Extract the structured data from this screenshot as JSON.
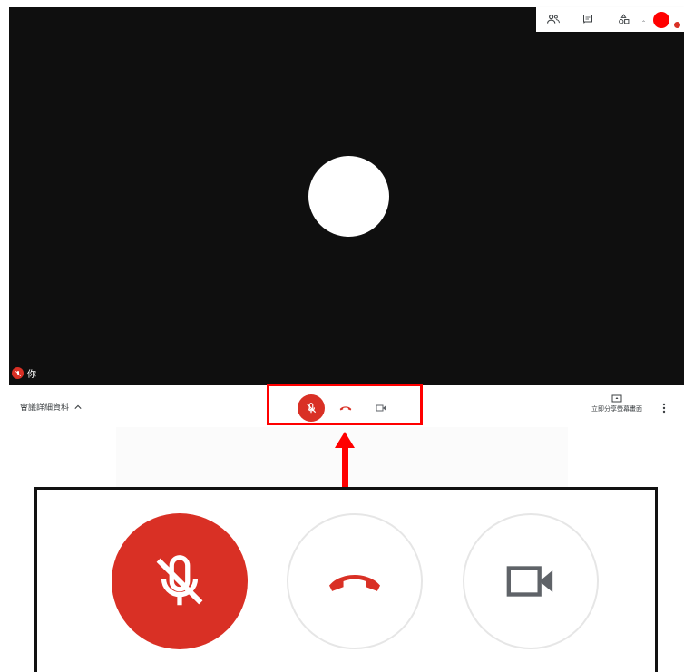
{
  "self_tile": {
    "name": "你"
  },
  "bottom_bar": {
    "meeting_details_label": "會議詳細資料",
    "present_label": "立即分享螢幕畫面"
  },
  "icons": {
    "participants": "people-icon",
    "chat": "chat-icon",
    "activities": "shapes-icon",
    "record": "record-dot-icon",
    "mic_off": "mic-off-icon",
    "hangup": "phone-hangup-icon",
    "camera": "videocam-icon",
    "present": "present-screen-icon",
    "more": "more-vert-icon"
  },
  "colors": {
    "stage_background": "#0f0f0f",
    "mic_off_red": "#d93025",
    "annotation_red": "#ff0000"
  }
}
